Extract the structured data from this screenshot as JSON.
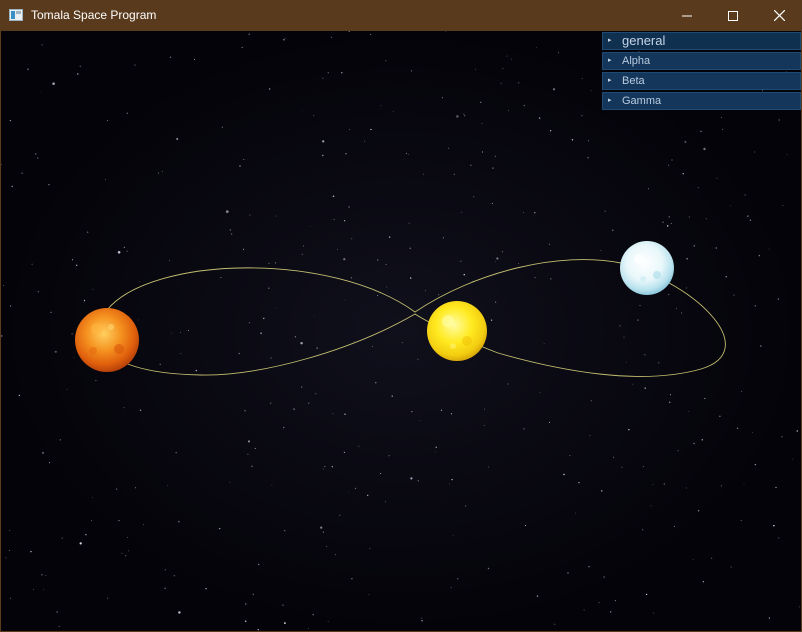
{
  "window": {
    "title": "Tomala Space Program",
    "buttons": {
      "minimize": "minimize-icon",
      "maximize": "maximize-icon",
      "close": "close-icon"
    }
  },
  "menu": {
    "header": "general",
    "items": [
      {
        "label": "Alpha"
      },
      {
        "label": "Beta"
      },
      {
        "label": "Gamma"
      }
    ],
    "arrow_glyph": "▸"
  },
  "scene": {
    "background": "#040309",
    "orbit_color": "#d8d37a",
    "bodies": [
      {
        "name": "orange-star",
        "color": "#f07a12"
      },
      {
        "name": "yellow-star",
        "color": "#ffe51c"
      },
      {
        "name": "white-star",
        "color": "#dff3f7"
      }
    ]
  },
  "colors": {
    "titlebar": "#5a3a1d",
    "menu_bg": "#13365a",
    "menu_text": "#b8cbe0"
  }
}
